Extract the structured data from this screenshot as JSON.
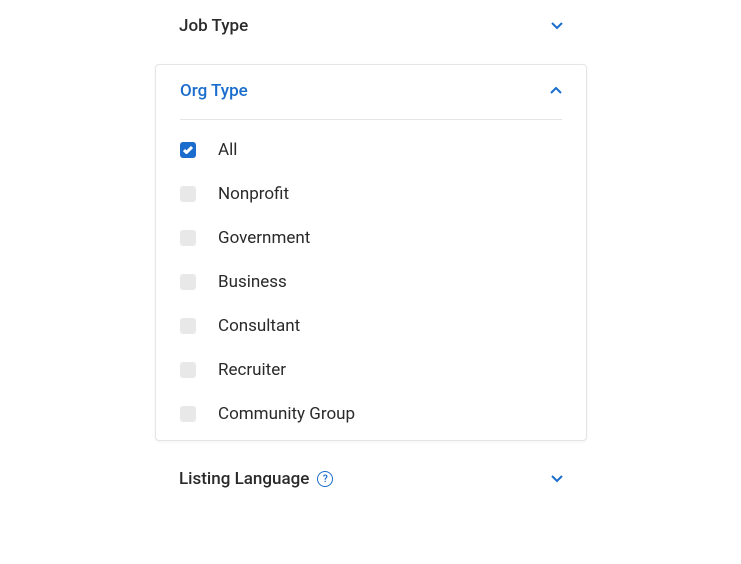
{
  "filters": {
    "job_type": {
      "title": "Job Type",
      "expanded": false
    },
    "org_type": {
      "title": "Org Type",
      "expanded": true,
      "options": [
        {
          "label": "All",
          "checked": true
        },
        {
          "label": "Nonprofit",
          "checked": false
        },
        {
          "label": "Government",
          "checked": false
        },
        {
          "label": "Business",
          "checked": false
        },
        {
          "label": "Consultant",
          "checked": false
        },
        {
          "label": "Recruiter",
          "checked": false
        },
        {
          "label": "Community Group",
          "checked": false
        }
      ]
    },
    "listing_language": {
      "title": "Listing Language",
      "expanded": false,
      "info_tooltip": "?"
    }
  },
  "colors": {
    "accent": "#1a6dcc",
    "text": "#2a2a2a",
    "border": "#e5e5e5",
    "checkbox_unchecked": "#e8e8e8"
  }
}
